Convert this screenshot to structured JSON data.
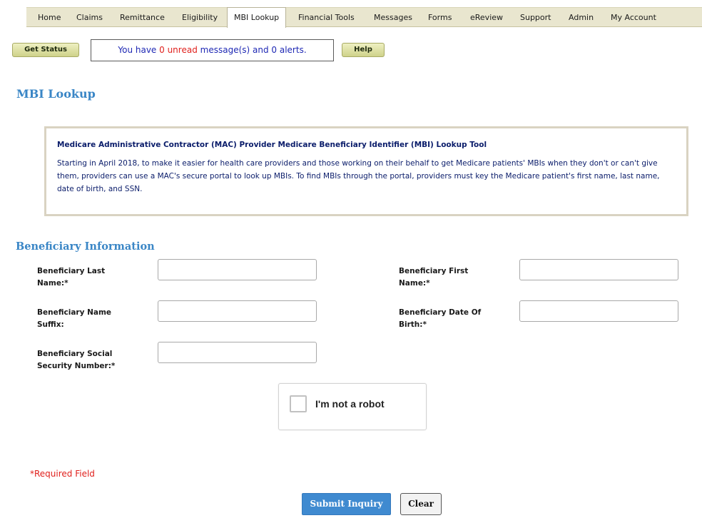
{
  "nav": {
    "tabs": [
      {
        "label": "Home"
      },
      {
        "label": "Claims"
      },
      {
        "label": "Remittance"
      },
      {
        "label": "Eligibility"
      },
      {
        "label": "MBI Lookup",
        "active": true
      },
      {
        "label": "Financial Tools"
      },
      {
        "label": "Messages"
      },
      {
        "label": "Forms"
      },
      {
        "label": "eReview"
      },
      {
        "label": "Support"
      },
      {
        "label": "Admin"
      },
      {
        "label": "My Account"
      }
    ]
  },
  "status": {
    "get_status_label": "Get Status",
    "help_label": "Help",
    "message_prefix": "You have ",
    "unread_count": "0",
    "unread_word": " unread",
    "message_mid": " message(s) and ",
    "alerts_count": "0",
    "message_suffix": " alerts."
  },
  "page": {
    "title": "MBI Lookup"
  },
  "info": {
    "title": "Medicare Administrative Contractor (MAC) Provider Medicare Beneficiary Identifier (MBI) Lookup Tool",
    "text": "Starting in April 2018, to make it easier for health care providers and those working on their behalf to get Medicare patients' MBIs when they don't or can't give them, providers can use a MAC's secure portal to look up MBIs. To find MBIs through the portal, providers must key the Medicare patient's first name, last name, date of birth, and SSN."
  },
  "form": {
    "section_title": "Beneficiary Information",
    "last_name_label": "Beneficiary Last Name:*",
    "first_name_label": "Beneficiary First Name:*",
    "suffix_label": "Beneficiary Name Suffix:",
    "dob_label": "Beneficiary Date Of Birth:*",
    "ssn_label": "Beneficiary Social Security Number:*",
    "last_name_value": "",
    "first_name_value": "",
    "suffix_value": "",
    "dob_value": "",
    "ssn_value": ""
  },
  "captcha": {
    "label": "I'm not a robot"
  },
  "footer": {
    "required_note": "*Required Field",
    "submit_label": "Submit Inquiry",
    "clear_label": "Clear"
  },
  "colors": {
    "accent_blue": "#3a86c6",
    "nav_bg": "#e9e6cf",
    "alert_red": "#e0201c",
    "info_text": "#0a1c6a"
  }
}
